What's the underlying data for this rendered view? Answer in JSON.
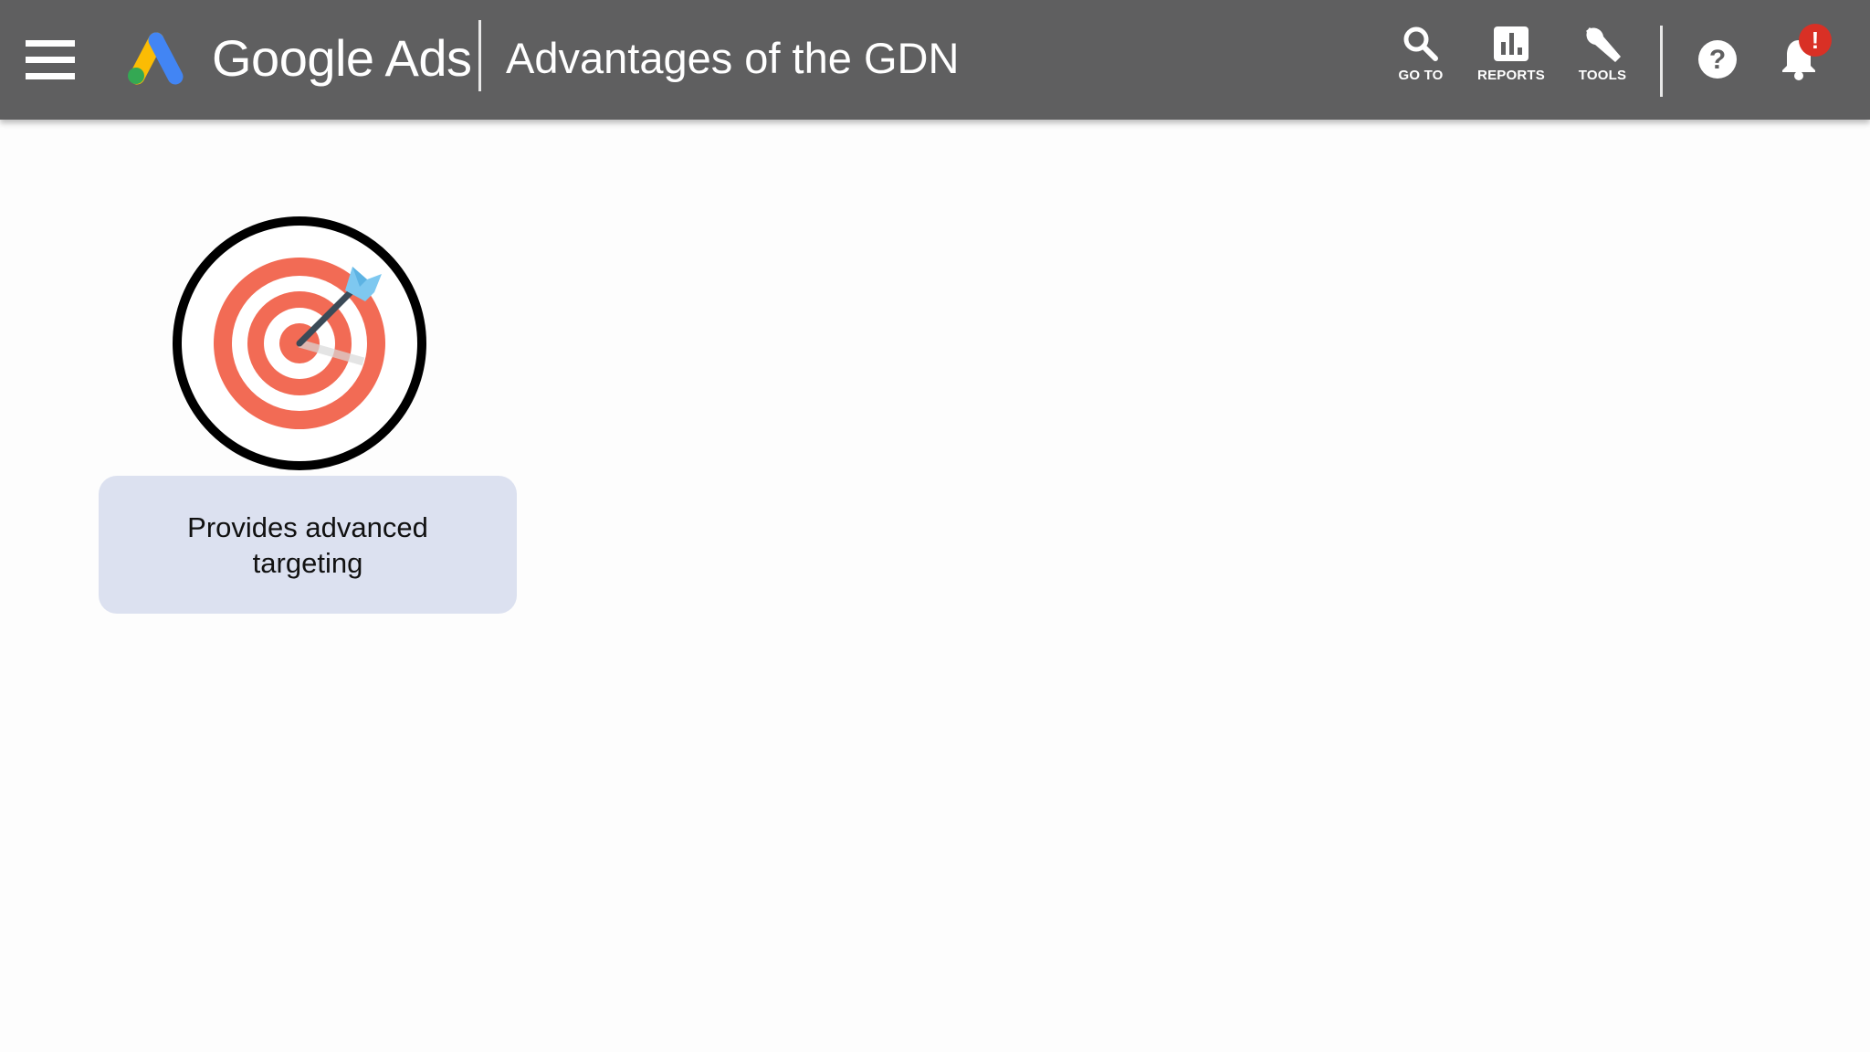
{
  "header": {
    "product_name": "Google Ads",
    "page_title": "Advantages of the GDN",
    "menu_icon": "hamburger-menu-icon",
    "logo_icon": "google-ads-logo",
    "tools": [
      {
        "label": "GO TO",
        "icon": "search-icon"
      },
      {
        "label": "REPORTS",
        "icon": "bar-chart-icon"
      },
      {
        "label": "TOOLS",
        "icon": "wrench-icon"
      }
    ],
    "help_icon": "help-circle-icon",
    "notifications_icon": "bell-icon",
    "notification_badge": "!",
    "colors": {
      "bar": "#5f5f60",
      "badge": "#d93025",
      "logo_blue": "#4285f4",
      "logo_yellow": "#fbbc04",
      "logo_green": "#34a853"
    }
  },
  "content": {
    "cards": [
      {
        "icon": "target-with-dart-icon",
        "text": "Provides advanced targeting",
        "colors": {
          "ring": "#f26b55",
          "dart": "#3b4a57",
          "fletching": "#7ec8f0",
          "caption_bg": "#dce1f0"
        }
      }
    ]
  }
}
